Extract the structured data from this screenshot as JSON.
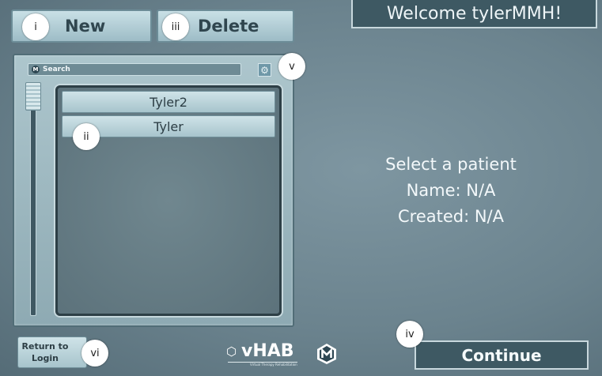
{
  "header": {
    "welcome_text": "Welcome tylerMMH!"
  },
  "toolbar": {
    "new_label": "New",
    "delete_label": "Delete",
    "new_badge": "i",
    "delete_badge": "iii"
  },
  "patient_panel": {
    "search_placeholder": "Search",
    "settings_badge": "v",
    "list_badge": "ii",
    "patients": [
      "Tyler2",
      "Tyler"
    ]
  },
  "details": {
    "prompt": "Select a patient",
    "name_line": "Name: N/A",
    "created_line": "Created: N/A"
  },
  "footer": {
    "return_label_line1": "Return to",
    "return_label_line2": "Login",
    "return_badge": "vi",
    "brand_name": "vHAB",
    "brand_tagline": "Virtual Therapy Rehabilitation",
    "continue_label": "Continue",
    "continue_badge": "iv"
  },
  "icons": {
    "gear": "gear-icon",
    "search": "search-icon",
    "logo": "m-logo-icon",
    "hexagon": "hexagon-icon"
  },
  "colors": {
    "background": "#6b838e",
    "button_light": "#c9e0e6",
    "panel_dark": "#3e5963",
    "text_light": "#f3f8fa"
  }
}
